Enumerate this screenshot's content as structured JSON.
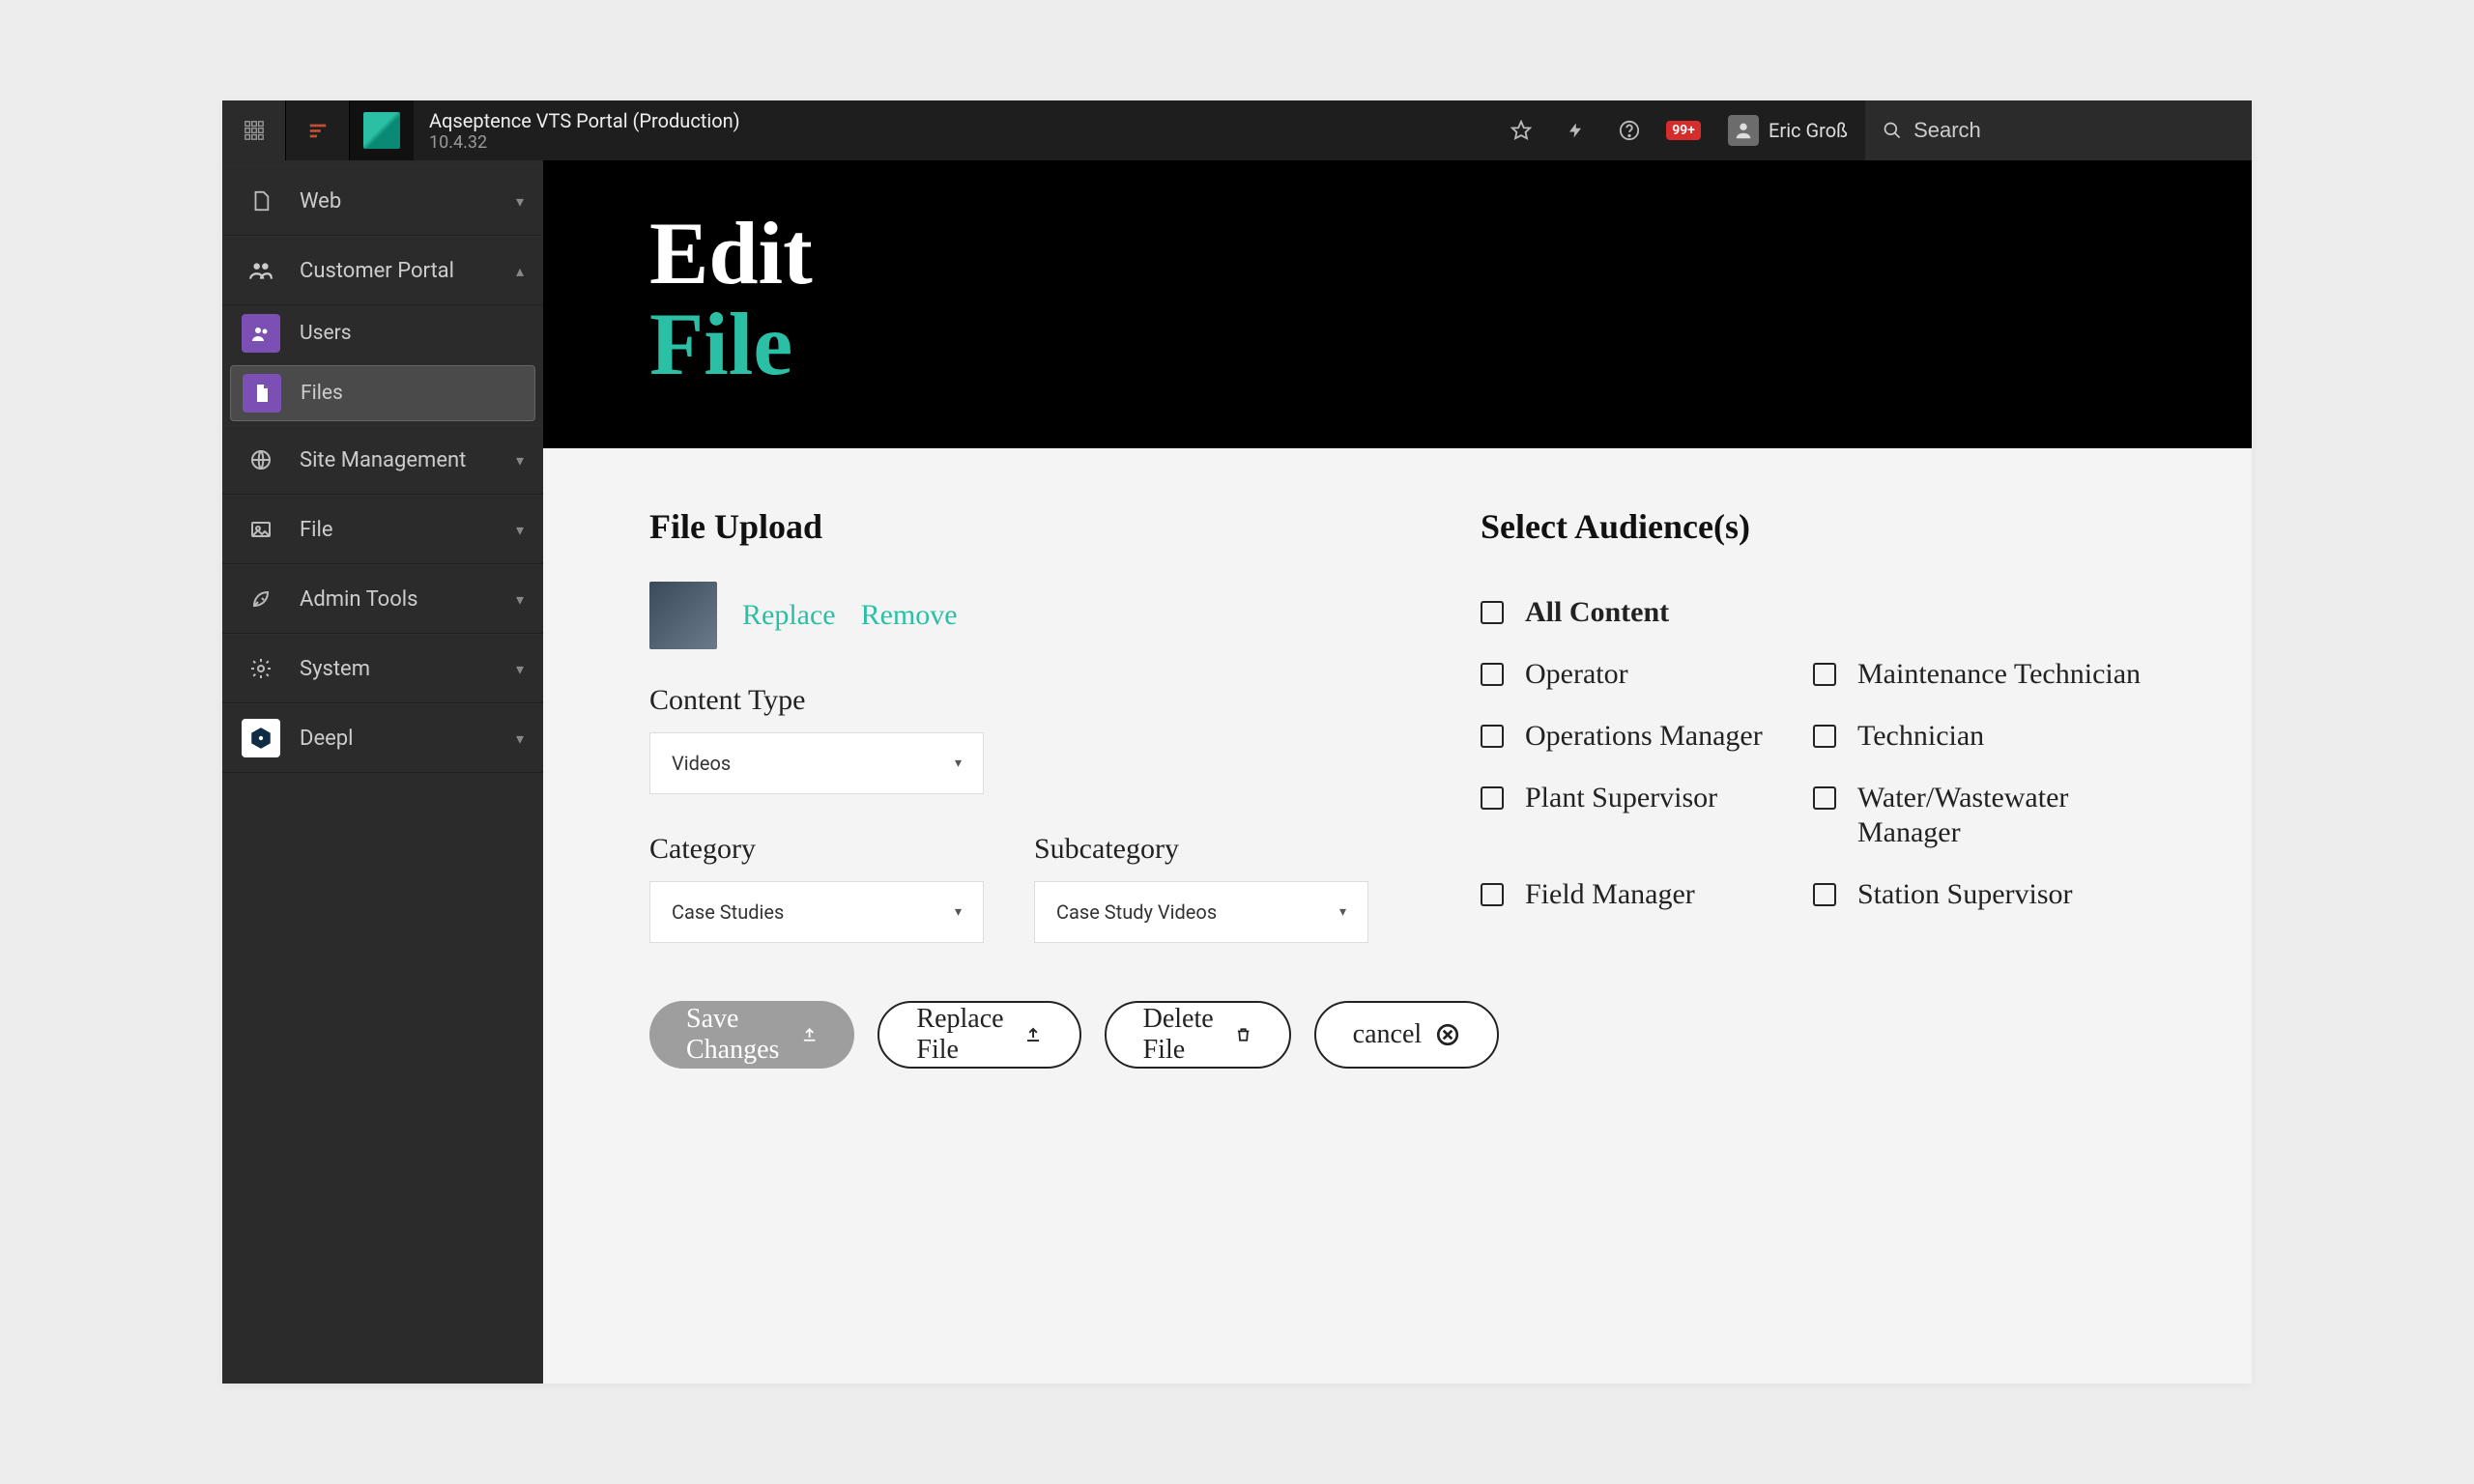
{
  "topbar": {
    "app_title": "Aqseptence VTS Portal (Production)",
    "version": "10.4.32",
    "badge": "99+",
    "user_name": "Eric Groß",
    "search_placeholder": "Search"
  },
  "sidebar": {
    "items": [
      {
        "label": "Web",
        "expanded": false
      },
      {
        "label": "Customer Portal",
        "expanded": true,
        "children": [
          {
            "label": "Users"
          },
          {
            "label": "Files",
            "active": true
          }
        ]
      },
      {
        "label": "Site Management",
        "expanded": false
      },
      {
        "label": "File",
        "expanded": false
      },
      {
        "label": "Admin Tools",
        "expanded": false
      },
      {
        "label": "System",
        "expanded": false
      },
      {
        "label": "Deepl",
        "expanded": false
      }
    ]
  },
  "hero": {
    "line1": "Edit",
    "line2": "File"
  },
  "upload": {
    "section_title": "File Upload",
    "replace": "Replace",
    "remove": "Remove",
    "content_type_label": "Content Type",
    "content_type_value": "Videos",
    "category_label": "Category",
    "category_value": "Case Studies",
    "subcategory_label": "Subcategory",
    "subcategory_value": "Case Study Videos"
  },
  "buttons": {
    "save": "Save Changes",
    "replace_file": "Replace File",
    "delete_file": "Delete File",
    "cancel": "cancel"
  },
  "audience": {
    "section_title": "Select Audience(s)",
    "all": "All Content",
    "pairs": [
      [
        "Operator",
        "Maintenance Technician"
      ],
      [
        "Operations Manager",
        "Technician"
      ],
      [
        "Plant Supervisor",
        "Water/Wastewater Manager"
      ],
      [
        "Field Manager",
        "Station Supervisor"
      ]
    ]
  }
}
